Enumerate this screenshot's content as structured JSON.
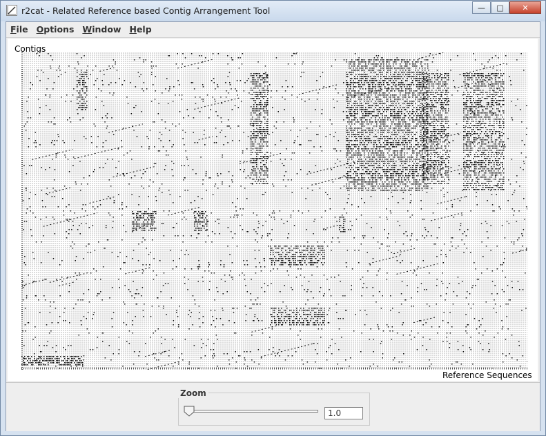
{
  "window": {
    "title": "r2cat - Related Reference based Contig Arrangement Tool",
    "icons": {
      "app": "graph-icon",
      "minimize": "minimize-icon",
      "maximize": "maximize-icon",
      "close": "close-icon"
    }
  },
  "menu": {
    "items": [
      {
        "label": "File",
        "mnemonic": "F",
        "rest": "ile"
      },
      {
        "label": "Options",
        "mnemonic": "O",
        "rest": "ptions"
      },
      {
        "label": "Window",
        "mnemonic": "W",
        "rest": "indow"
      },
      {
        "label": "Help",
        "mnemonic": "H",
        "rest": "elp"
      }
    ]
  },
  "plot": {
    "y_label": "Contigs",
    "x_label": "Reference Sequences"
  },
  "zoom": {
    "title": "Zoom",
    "value": "1.0",
    "slider_fraction": 0.0
  },
  "colors": {
    "plot_background": "#ffffff",
    "stripe": "#b9b9b9",
    "matches": "#111111",
    "panel": "#eeeeee"
  }
}
